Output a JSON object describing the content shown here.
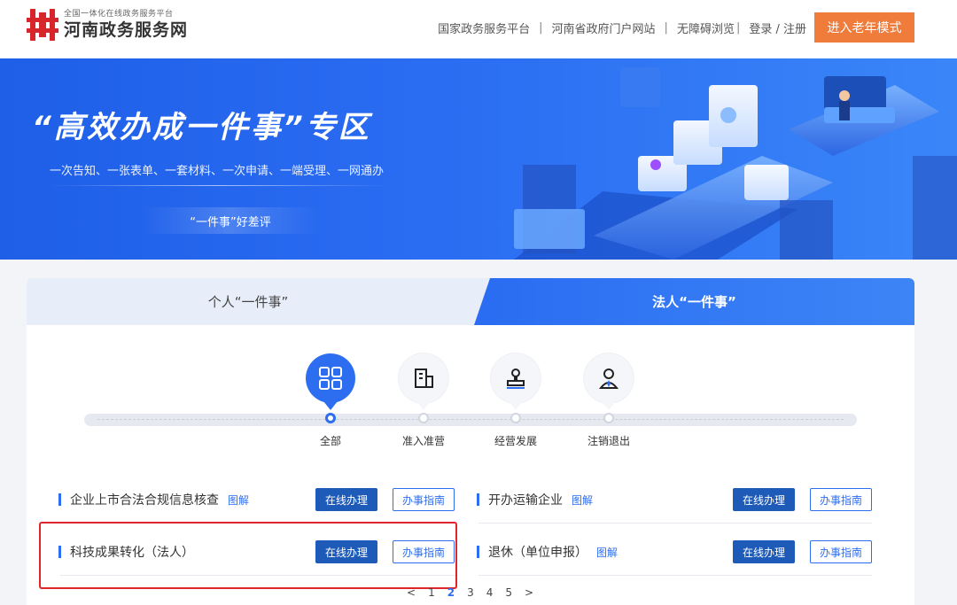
{
  "header": {
    "logo_subtitle": "全国一体化在线政务服务平台",
    "logo_title": "河南政务服务网",
    "nav": [
      "国家政务服务平台",
      "河南省政府门户网站",
      "无障碍浏览"
    ],
    "login": "登录 / 注册",
    "elder_mode": "进入老年模式"
  },
  "banner": {
    "title": "“高效办成一件事”专区",
    "subtitle": "一次告知、一张表单、一套材料、一次申请、一端受理、一网通办",
    "evaluation": "“一件事”好差评"
  },
  "tabs": {
    "personal": "个人“一件事”",
    "legal": "法人“一件事”",
    "active": "legal"
  },
  "stages": [
    {
      "label": "全部",
      "icon": "grid-icon",
      "active": true
    },
    {
      "label": "准入准营",
      "icon": "building-icon",
      "active": false
    },
    {
      "label": "经营发展",
      "icon": "stamp-icon",
      "active": false
    },
    {
      "label": "注销退出",
      "icon": "person-icon",
      "active": false
    }
  ],
  "items": [
    {
      "name": "企业上市合法合规信息核查",
      "tag": "图解",
      "online": "在线办理",
      "guide": "办事指南"
    },
    {
      "name": "开办运输企业",
      "tag": "图解",
      "online": "在线办理",
      "guide": "办事指南"
    },
    {
      "name": "科技成果转化（法人）",
      "tag": "",
      "online": "在线办理",
      "guide": "办事指南"
    },
    {
      "name": "退休（单位申报）",
      "tag": "图解",
      "online": "在线办理",
      "guide": "办事指南"
    }
  ],
  "pager": {
    "prev": "<",
    "pages": [
      "1",
      "2",
      "3",
      "4",
      "5"
    ],
    "current": "2",
    "next": ">"
  },
  "colors": {
    "primary": "#2d6ef0",
    "button_dark": "#1e5bb8",
    "elder": "#f07c3c",
    "highlight": "#e0262a"
  }
}
